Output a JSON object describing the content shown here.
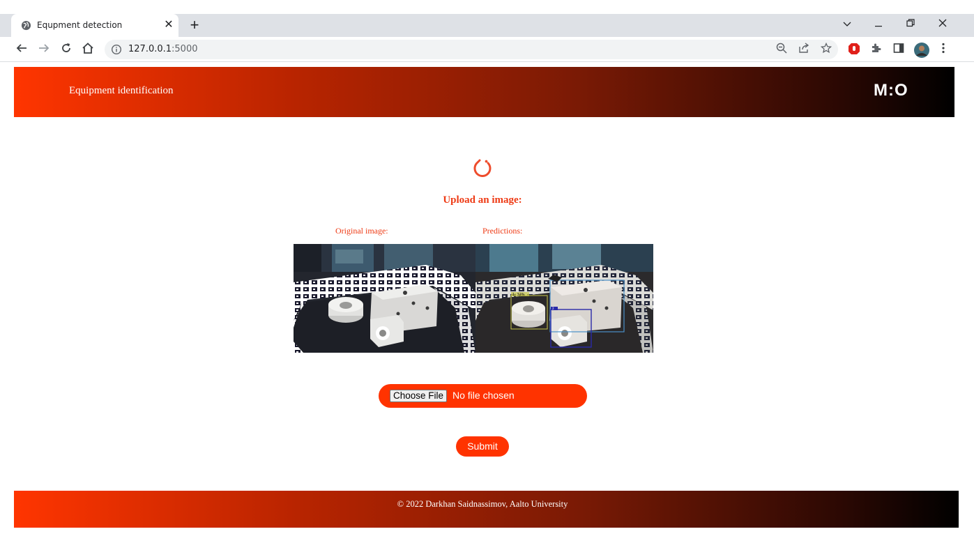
{
  "browser": {
    "tab_title": "Equpment detection",
    "url_host": "127.0.0.1",
    "url_port": ":5000",
    "icons": [
      "globe-icon",
      "close-icon",
      "plus-icon",
      "tab-search-icon",
      "minimize-icon",
      "restore-icon",
      "window-close-icon",
      "back-icon",
      "forward-icon",
      "reload-icon",
      "home-icon",
      "info-icon",
      "zoom-icon",
      "share-icon",
      "star-icon",
      "adblock-icon",
      "extensions-icon",
      "side-panel-icon",
      "profile-avatar",
      "menu-icon"
    ]
  },
  "header": {
    "title": "Equipment identification",
    "logo": "M:O"
  },
  "main": {
    "upload_heading": "Upload an image:",
    "original_label": "Original image:",
    "predictions_label": "Predictions:",
    "prediction_tags": [
      "1: 32%",
      "2"
    ],
    "file_button": "Choose File",
    "file_status": "No file chosen",
    "submit_label": "Submit"
  },
  "footer": {
    "text": "© 2022 Darkhan Saidnassimov, Aalto University"
  },
  "colors": {
    "accent": "#ff3300",
    "heading": "#ee3a14",
    "gradient_start": "#ff3500",
    "gradient_end": "#000000"
  }
}
